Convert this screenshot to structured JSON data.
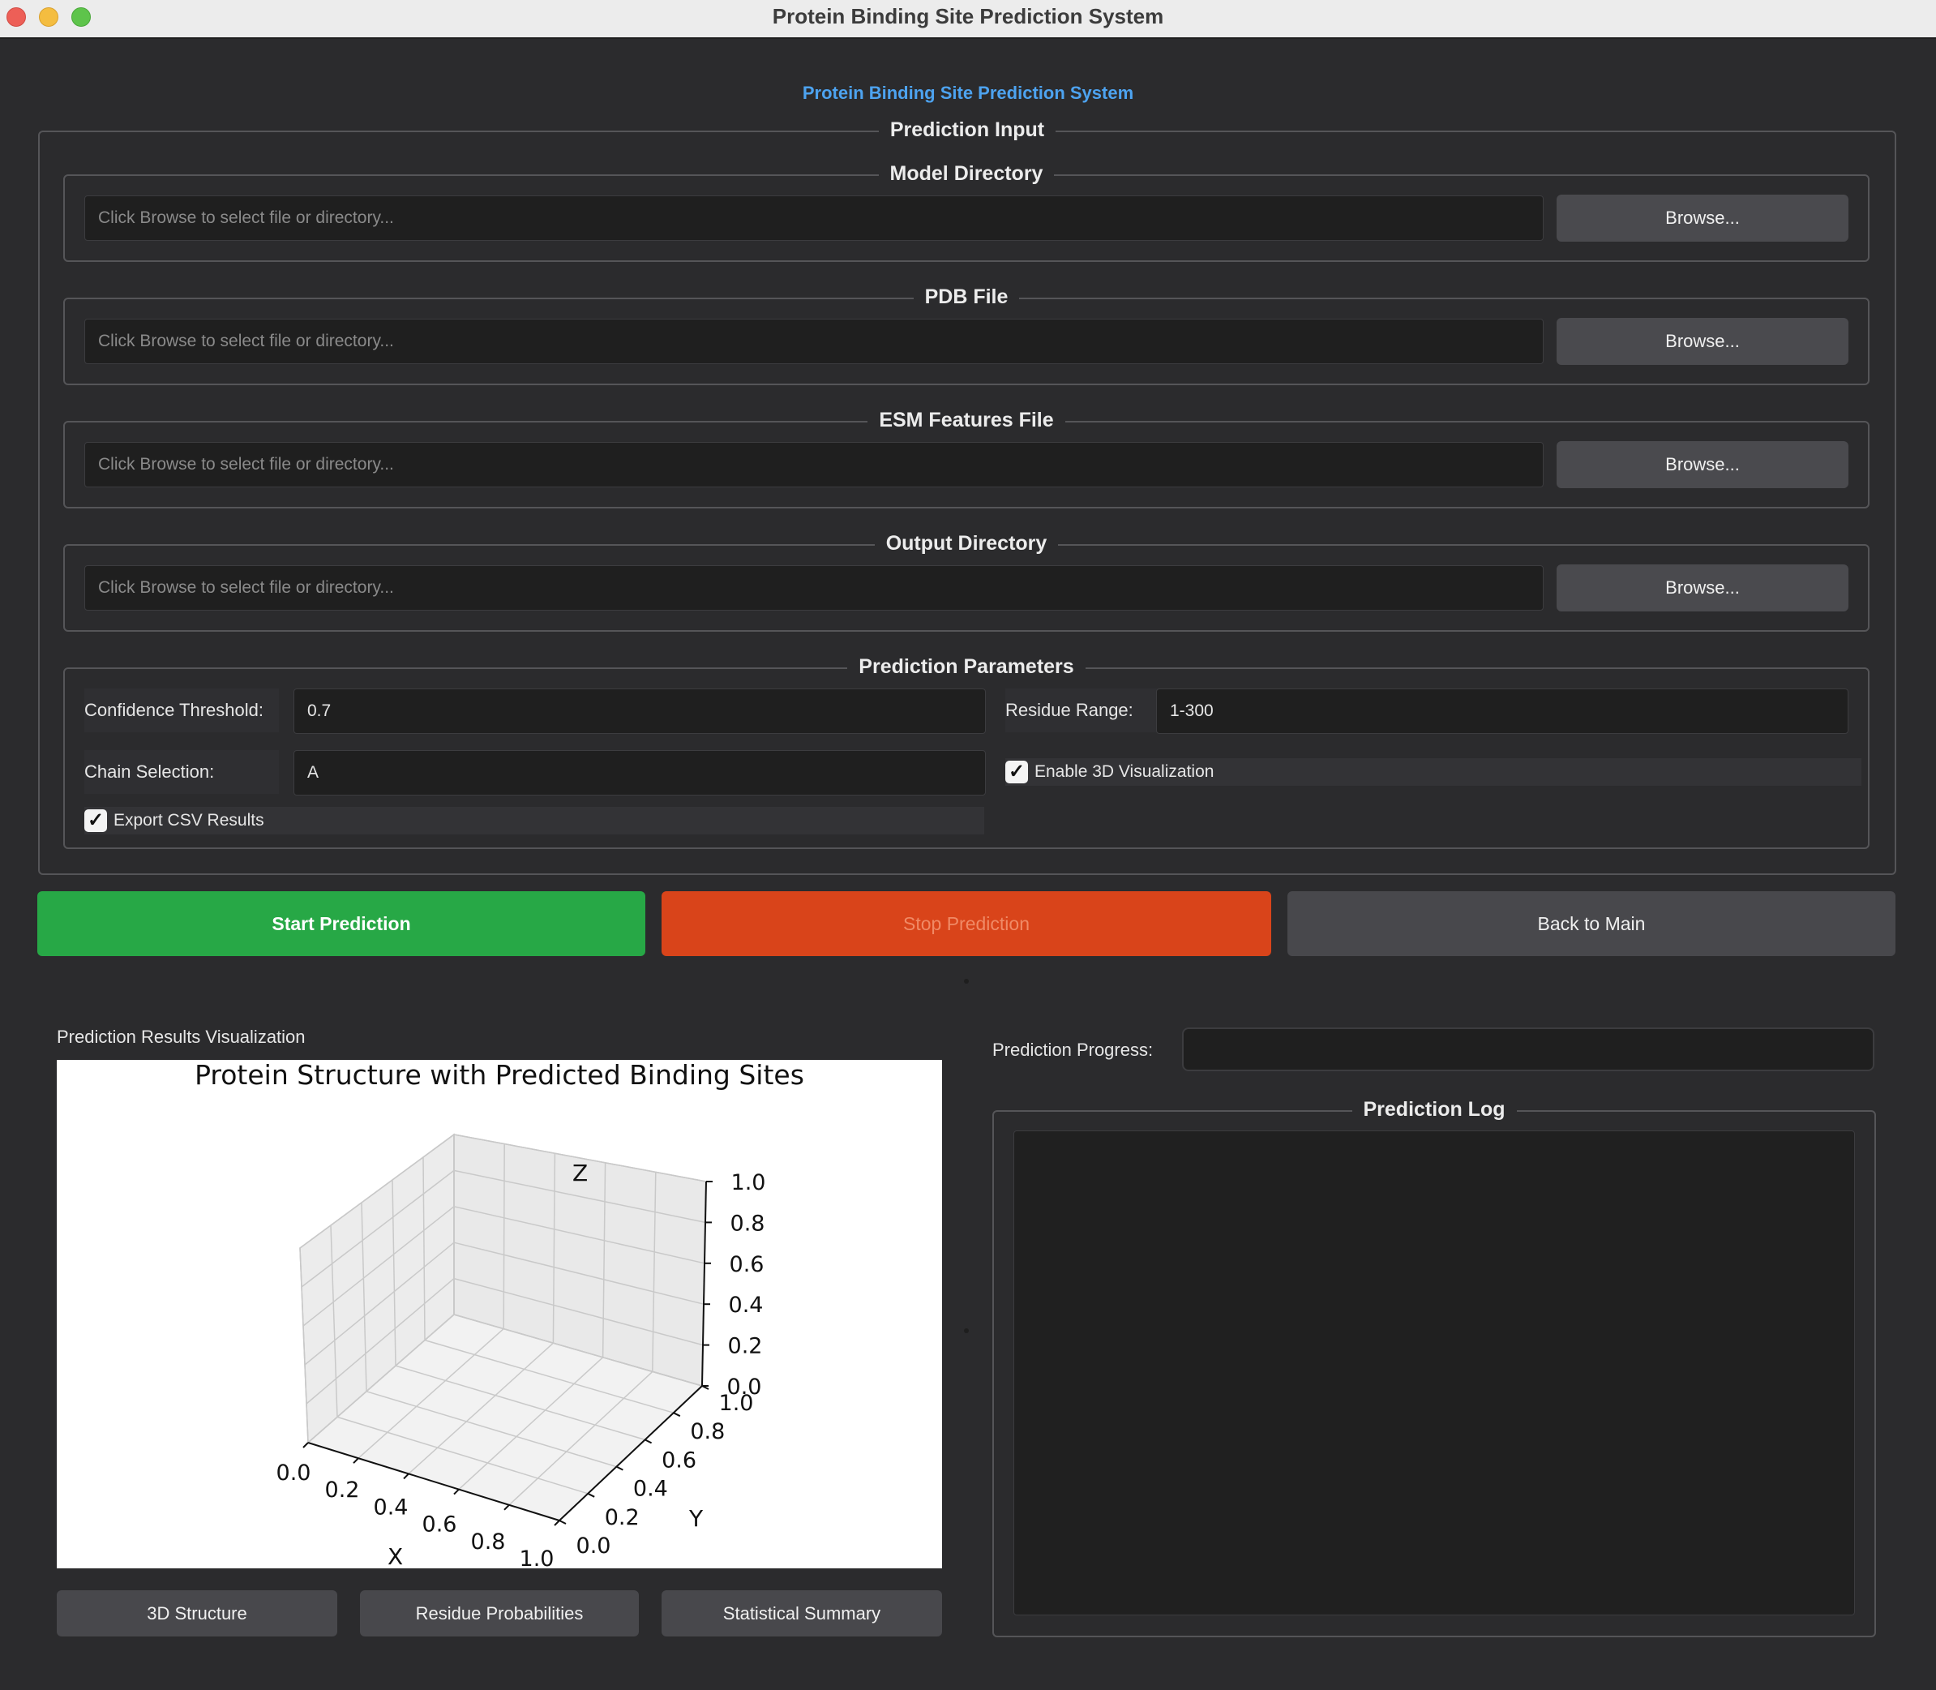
{
  "window": {
    "title": "Protein Binding Site Prediction System"
  },
  "app_heading": "Protein Binding Site Prediction System",
  "prediction_input": {
    "title": "Prediction Input",
    "browse_label": "Browse...",
    "path_placeholder": "Click Browse to select file or directory...",
    "fields": [
      {
        "title": "Model Directory",
        "value": ""
      },
      {
        "title": "PDB File",
        "value": ""
      },
      {
        "title": "ESM Features File",
        "value": ""
      },
      {
        "title": "Output Directory",
        "value": ""
      }
    ]
  },
  "parameters": {
    "title": "Prediction Parameters",
    "confidence_label": "Confidence Threshold:",
    "confidence_value": "0.7",
    "residue_label": "Residue Range:",
    "residue_value": "1-300",
    "chain_label": "Chain Selection:",
    "chain_value": "A",
    "enable_3d_label": "Enable 3D Visualization",
    "enable_3d_checked": true,
    "export_csv_label": "Export CSV Results",
    "export_csv_checked": true
  },
  "actions": {
    "start": "Start Prediction",
    "stop": "Stop Prediction",
    "back": "Back to Main"
  },
  "results": {
    "label": "Prediction Results Visualization",
    "tabs": [
      "3D Structure",
      "Residue Probabilities",
      "Statistical Summary"
    ]
  },
  "progress": {
    "label": "Prediction Progress:",
    "value": 0
  },
  "log": {
    "title": "Prediction Log",
    "content": ""
  },
  "colors": {
    "start": "#27a846",
    "stop": "#d9441a",
    "back": "#48484c",
    "heading": "#4da3f0"
  },
  "chart_data": {
    "type": "scatter",
    "projection": "3d",
    "title": "Protein Structure with Predicted Binding Sites",
    "xlabel": "X",
    "ylabel": "Y",
    "zlabel": "Z",
    "xlim": [
      0,
      1
    ],
    "ylim": [
      0,
      1
    ],
    "zlim": [
      0,
      1
    ],
    "x_ticks": [
      "0.0",
      "0.2",
      "0.4",
      "0.6",
      "0.8",
      "1.0"
    ],
    "y_ticks": [
      "0.0",
      "0.2",
      "0.4",
      "0.6",
      "0.8",
      "1.0"
    ],
    "z_ticks": [
      "0.0",
      "0.2",
      "0.4",
      "0.6",
      "0.8",
      "1.0"
    ],
    "grid": true,
    "series": []
  }
}
